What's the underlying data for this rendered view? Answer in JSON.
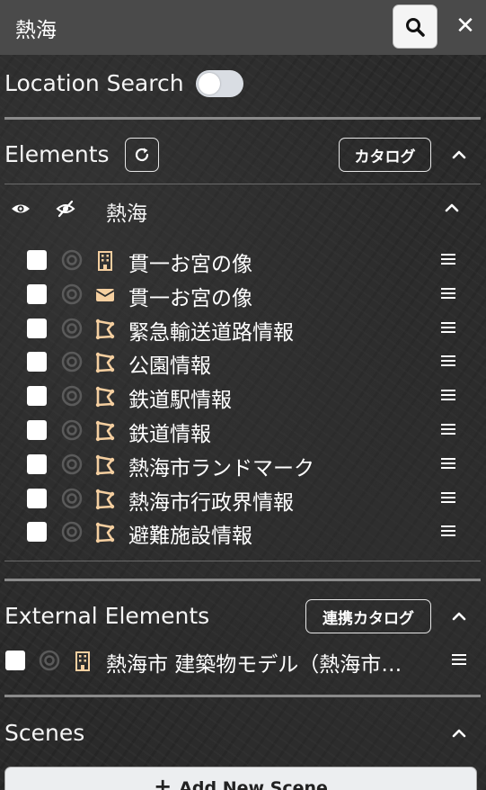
{
  "header": {
    "title": "熱海",
    "search_icon": "search-icon",
    "close_label": "✕"
  },
  "location_search": {
    "label": "Location Search",
    "enabled": false
  },
  "elements": {
    "title": "Elements",
    "catalog_label": "カタログ",
    "group": {
      "name": "熱海",
      "items": [
        {
          "label": "貫一お宮の像",
          "icon": "building-icon"
        },
        {
          "label": "貫一お宮の像",
          "icon": "envelope-icon"
        },
        {
          "label": "緊急輸送道路情報",
          "icon": "map-polygon-icon"
        },
        {
          "label": "公園情報",
          "icon": "map-polygon-icon"
        },
        {
          "label": "鉄道駅情報",
          "icon": "map-polygon-icon"
        },
        {
          "label": "鉄道情報",
          "icon": "map-polygon-icon"
        },
        {
          "label": "熱海市ランドマーク",
          "icon": "map-polygon-icon"
        },
        {
          "label": "熱海市行政界情報",
          "icon": "map-polygon-icon"
        },
        {
          "label": "避難施設情報",
          "icon": "map-polygon-icon"
        }
      ]
    }
  },
  "external": {
    "title": "External Elements",
    "catalog_label": "連携カタログ",
    "items": [
      {
        "label": "熱海市 建築物モデル（熱海市…",
        "icon": "building-icon"
      }
    ]
  },
  "scenes": {
    "title": "Scenes",
    "add_label": "Add New Scene"
  },
  "colors": {
    "icon_accent": "#f5cfa0",
    "header_bg": "#4a4a4a"
  }
}
